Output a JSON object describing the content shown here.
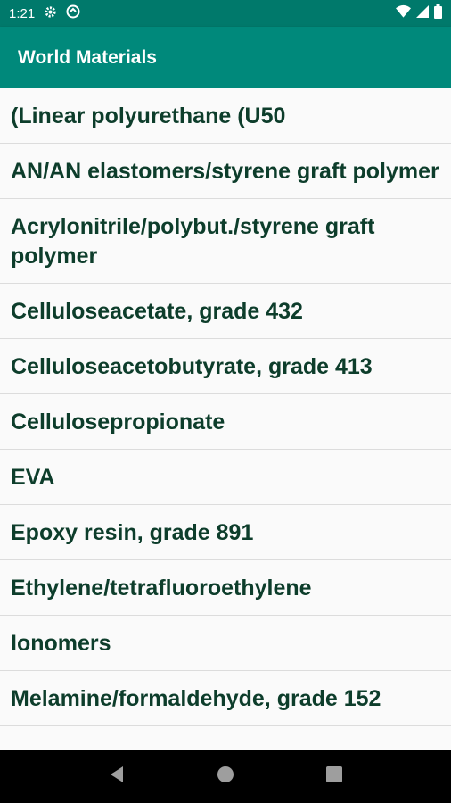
{
  "status_bar": {
    "time": "1:21",
    "icons": [
      "gear-icon",
      "circle-badge-icon",
      "wifi-icon",
      "cellular-signal-icon",
      "battery-icon"
    ]
  },
  "app_bar": {
    "title": "World Materials",
    "color": "#00897b"
  },
  "materials": [
    "(Linear polyurethane (U50",
    "AN/AN elastomers/styrene graft polymer",
    "Acrylonitrile/polybut./styrene graft polymer",
    "Celluloseacetate, grade 432",
    "Celluloseacetobutyrate, grade 413",
    "Cellulosepropionate",
    "EVA",
    "Epoxy resin, grade 891",
    "Ethylene/tetrafluoroethylene",
    "Ionomers",
    "Melamine/formaldehyde, grade 152"
  ],
  "nav_bar": {
    "buttons": [
      "back-icon",
      "home-icon",
      "recents-icon"
    ]
  },
  "colors": {
    "status_bar": "#00796b",
    "item_text": "#0d3d2b",
    "background": "#fafafa"
  }
}
